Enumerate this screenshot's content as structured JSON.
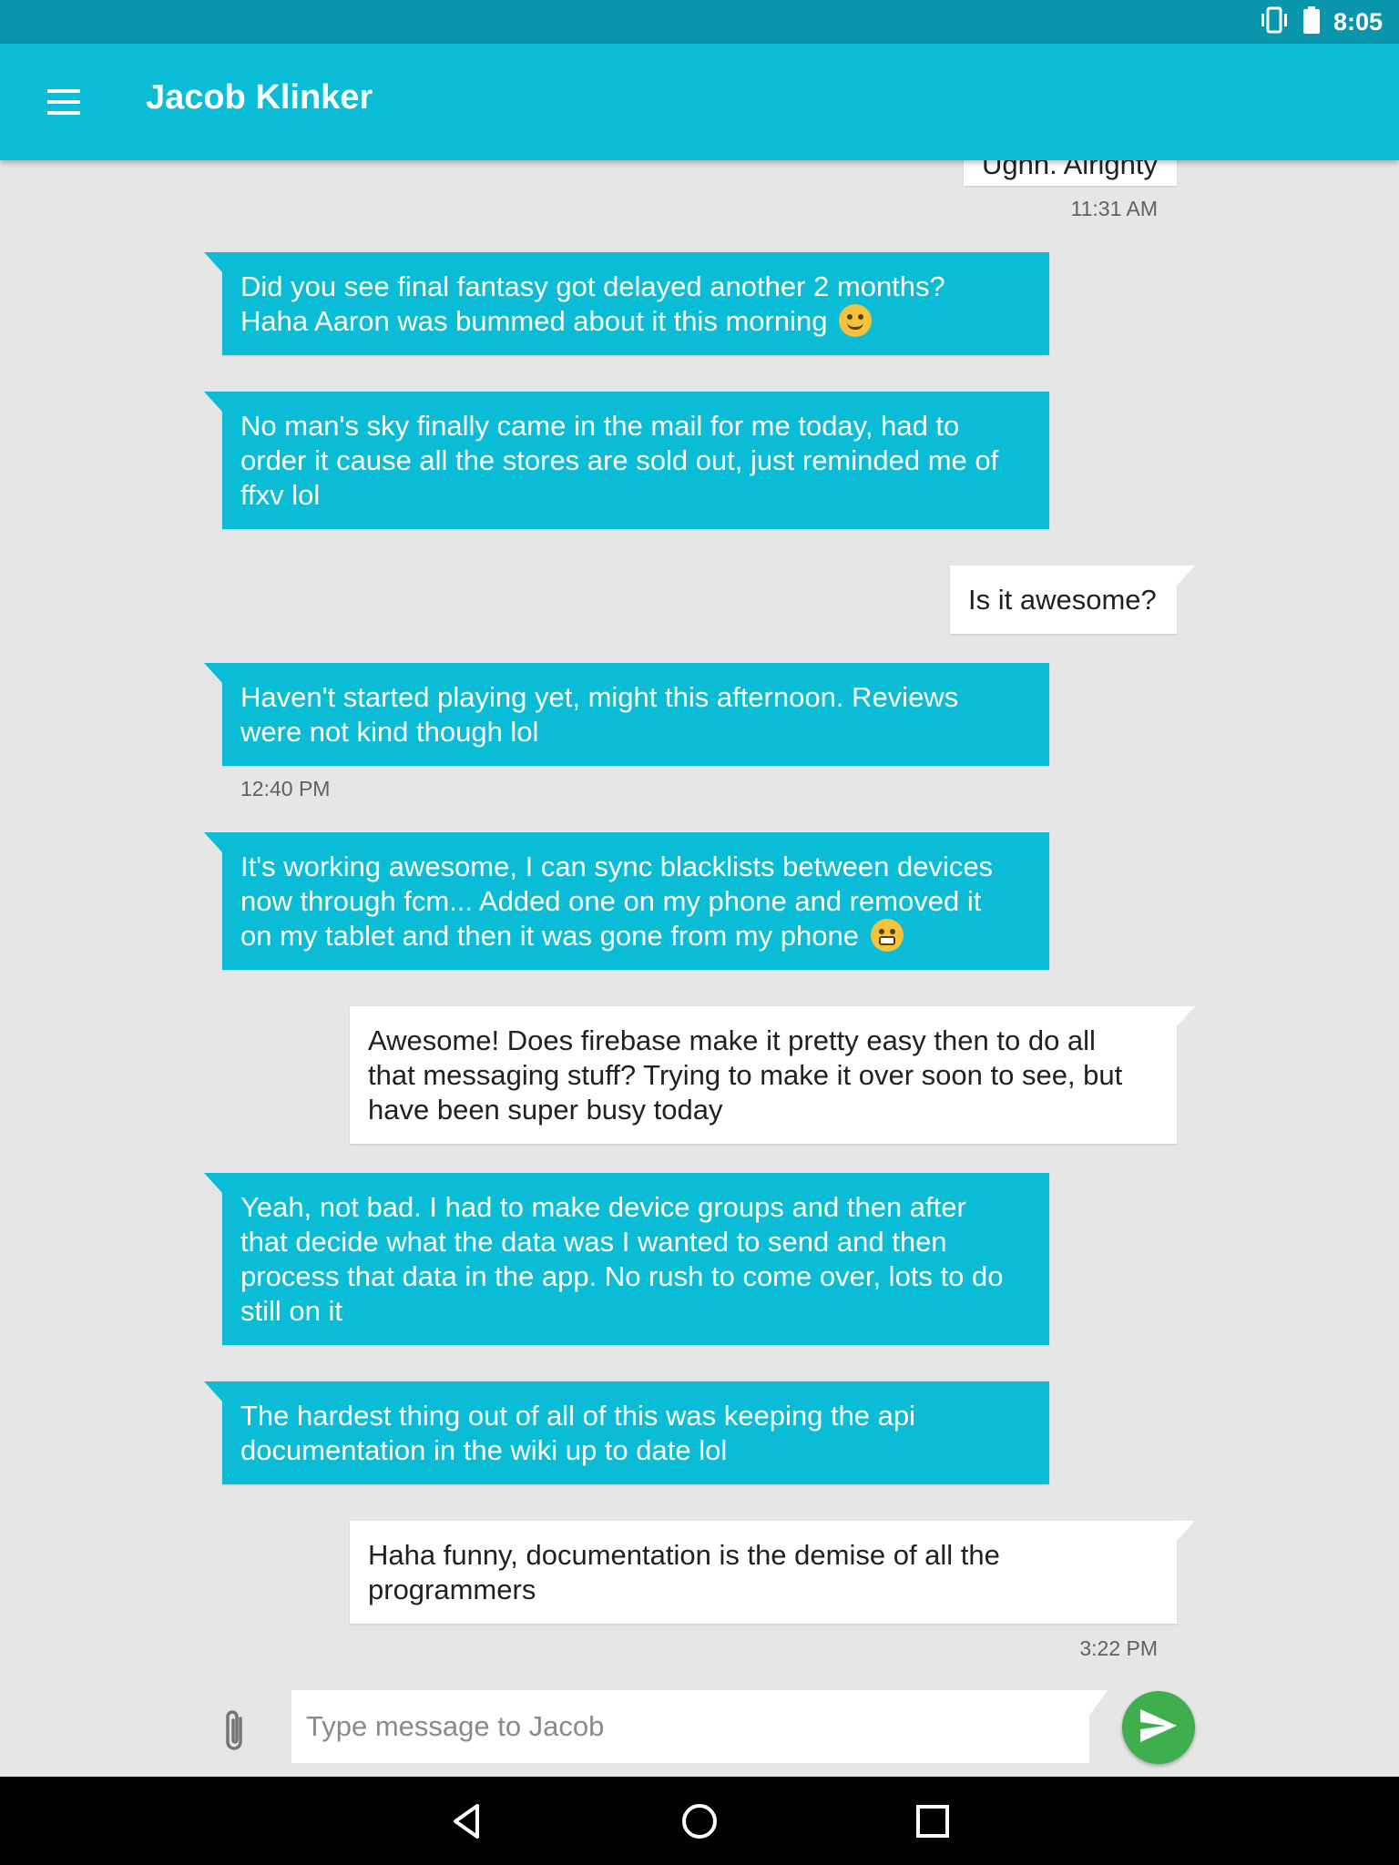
{
  "status_bar": {
    "time": "8:05",
    "icons": [
      "vibrate-icon",
      "battery-icon"
    ]
  },
  "app_bar": {
    "title": "Jacob Klinker",
    "menu_icon": "hamburger-menu-icon"
  },
  "conversation": {
    "clipped_top_message": "Ughh. Alrighty",
    "timestamps": {
      "first": "11:31 AM",
      "second": "12:40 PM",
      "third": "3:22 PM"
    },
    "messages": [
      {
        "direction": "incoming",
        "lines": [
          "Did you see final fantasy got delayed another 2 months?",
          "Haha Aaron was bummed about it this morning"
        ],
        "emoji": "yum-face"
      },
      {
        "direction": "incoming",
        "lines": [
          "No man's sky finally came in the mail for me today, had to",
          "order it cause all the stores are sold out, just reminded me of",
          "ffxv lol"
        ]
      },
      {
        "direction": "outgoing",
        "lines": [
          "Is it awesome?"
        ]
      },
      {
        "direction": "incoming",
        "lines": [
          "Haven't started playing yet, might this afternoon. Reviews",
          "were not kind though lol"
        ]
      },
      {
        "direction": "incoming",
        "lines": [
          "It's working awesome, I can sync blacklists between devices",
          "now through fcm... Added one on my phone and removed it",
          "on my tablet and then it was gone from my phone"
        ],
        "emoji": "grimacing-face"
      },
      {
        "direction": "outgoing",
        "lines": [
          "Awesome! Does firebase make it pretty easy then to do all",
          "that messaging stuff? Trying to make it over soon to see, but",
          "have been super busy today"
        ]
      },
      {
        "direction": "incoming",
        "lines": [
          "Yeah, not bad. I had to make device groups and then after",
          "that decide what the data was I wanted to send and then",
          "process that data in the app. No rush to come over, lots to do",
          "still on it"
        ]
      },
      {
        "direction": "incoming",
        "lines": [
          "The hardest thing out of all of this was keeping the api",
          "documentation in the wiki up to date lol"
        ]
      },
      {
        "direction": "outgoing",
        "lines": [
          "Haha funny, documentation is the demise of all the",
          "programmers"
        ]
      }
    ]
  },
  "composer": {
    "placeholder": "Type message to Jacob",
    "attach_icon": "paperclip-icon",
    "send_icon": "send-icon",
    "send_color": "#3fae4d"
  },
  "nav_bar": {
    "buttons": [
      "back-icon",
      "home-icon",
      "recents-icon"
    ]
  },
  "colors": {
    "primary": "#0bbcd6",
    "primary_dark": "#0996ad",
    "incoming_bubble": "#0bbcd6",
    "outgoing_bubble": "#ffffff",
    "background": "#e6e6e6"
  }
}
